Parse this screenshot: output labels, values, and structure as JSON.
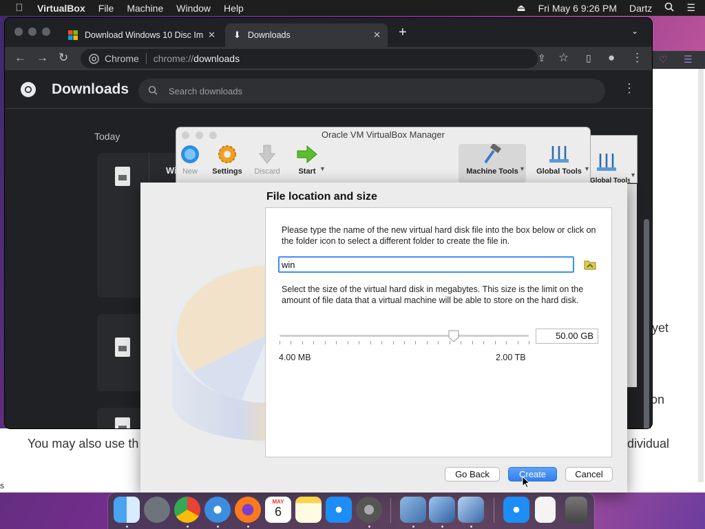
{
  "menubar": {
    "apple": "",
    "app_name": "VirtualBox",
    "items": [
      "File",
      "Machine",
      "Window",
      "Help"
    ],
    "datetime": "Fri May 6  9:26 PM",
    "user": "Dartz"
  },
  "chrome": {
    "tabs": [
      {
        "label": "Download Windows 10 Disc Im",
        "active": false
      },
      {
        "label": "Downloads",
        "active": true
      }
    ],
    "omnibox_site": "Chrome",
    "url_prefix": "chrome://",
    "url_host": "downloads",
    "page_title": "Downloads",
    "search_placeholder": "Search downloads",
    "date_group": "Today",
    "card_fragment": "Wi"
  },
  "webpage": {
    "fragments": [
      "yet",
      "on",
      "You may also use th",
      "dividual"
    ],
    "stray": "s"
  },
  "vbox_manager": {
    "title": "Oracle VM VirtualBox Manager",
    "tools": [
      {
        "label": "New",
        "enabled": false
      },
      {
        "label": "Settings",
        "enabled": true
      },
      {
        "label": "Discard",
        "enabled": false
      },
      {
        "label": "Start",
        "enabled": true
      },
      {
        "label": "Machine Tools",
        "enabled": true
      },
      {
        "label": "Global Tools",
        "enabled": true
      }
    ],
    "second_window_label": "Global Tools"
  },
  "dialog": {
    "heading": "File location and size",
    "location_help": "Please type the name of the new virtual hard disk file into the box below or click on the folder icon to select a different folder to create the file in.",
    "file_name": "win",
    "size_help": "Select the size of the virtual hard disk in megabytes. This size is the limit on the amount of file data that a virtual machine will be able to store on the hard disk.",
    "size_value": "50.00 GB",
    "slider_fraction": 0.7,
    "min_label": "4.00 MB",
    "max_label": "2.00 TB",
    "buttons": {
      "back": "Go Back",
      "create": "Create",
      "cancel": "Cancel"
    }
  },
  "dock": {
    "calendar_month": "MAY",
    "calendar_day": "6"
  },
  "colors": {
    "accent": "#3d8ef5",
    "chrome_bg": "#202124"
  }
}
